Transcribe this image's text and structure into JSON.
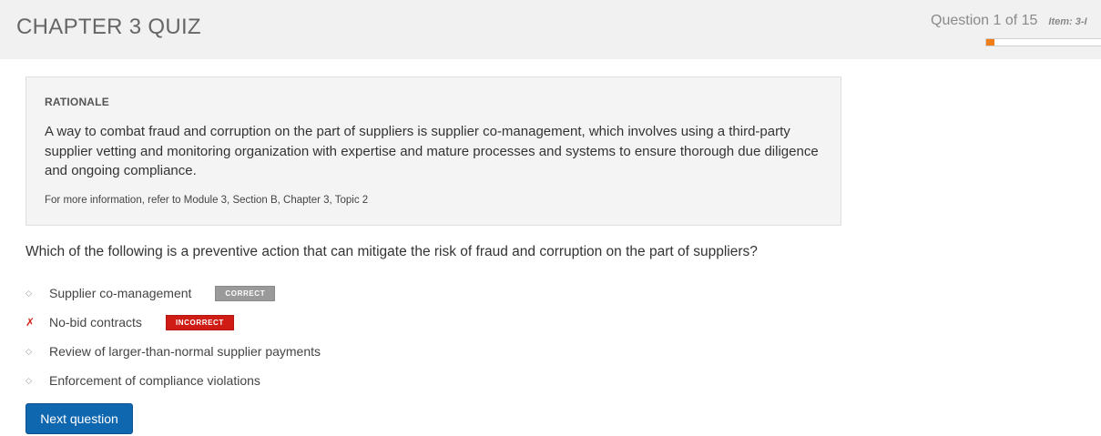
{
  "header": {
    "title": "CHAPTER 3 QUIZ",
    "question_counter": "Question 1 of 15",
    "item_id": "Item: 3-I",
    "progress_fraction": 0.0667,
    "progress_color": "#f07d17"
  },
  "rationale": {
    "heading": "RATIONALE",
    "body": "A way to combat fraud and corruption on the part of suppliers is supplier co-management, which involves using a third-party supplier vetting and monitoring organization with expertise and mature processes and systems to ensure thorough due diligence and ongoing compliance.",
    "reference": "For more information, refer to Module 3, Section B, Chapter 3, Topic 2"
  },
  "question": {
    "text": "Which of the following is a preventive action that can mitigate the risk of fraud and corruption on the part of suppliers?"
  },
  "answers": [
    {
      "marker": "◇",
      "text": "Supplier co-management",
      "badge": "CORRECT"
    },
    {
      "marker": "✗",
      "text": "No-bid contracts",
      "badge": "INCORRECT"
    },
    {
      "marker": "◇",
      "text": "Review of larger-than-normal supplier payments"
    },
    {
      "marker": "◇",
      "text": "Enforcement of compliance violations"
    }
  ],
  "actions": {
    "next_label": "Next question",
    "button_color": "#0f67b0"
  }
}
